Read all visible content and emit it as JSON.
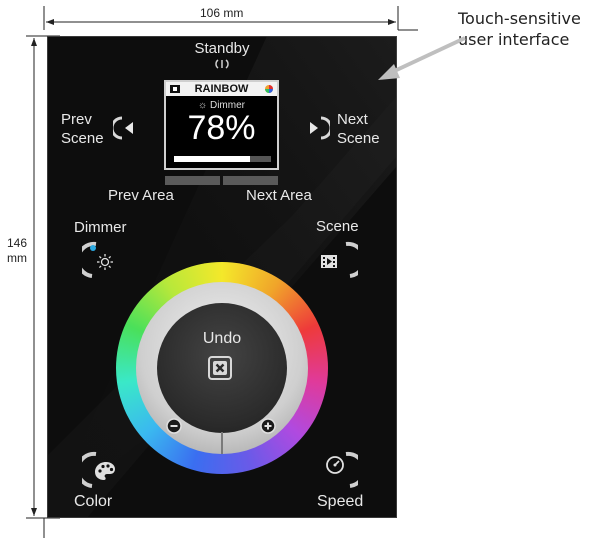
{
  "dimensions": {
    "width_label": "106 mm",
    "height_label_line1": "146",
    "height_label_line2": "mm"
  },
  "callout": {
    "line1": "Touch-sensitive",
    "line2": "user interface"
  },
  "labels": {
    "standby": "Standby",
    "prev_scene_line1": "Prev",
    "prev_scene_line2": "Scene",
    "next_scene_line1": "Next",
    "next_scene_line2": "Scene",
    "prev_area": "Prev Area",
    "next_area": "Next Area",
    "dimmer": "Dimmer",
    "scene": "Scene",
    "undo": "Undo",
    "color": "Color",
    "speed": "Speed"
  },
  "screen": {
    "title": "RAINBOW",
    "mode": "Dimmer",
    "percent_text": "78%",
    "level": 0.78
  },
  "colors": {
    "panel": "#0d0d0d",
    "dimmer_indicator": "#2aa8e0",
    "callout_arrow": "#bfbfbf"
  }
}
